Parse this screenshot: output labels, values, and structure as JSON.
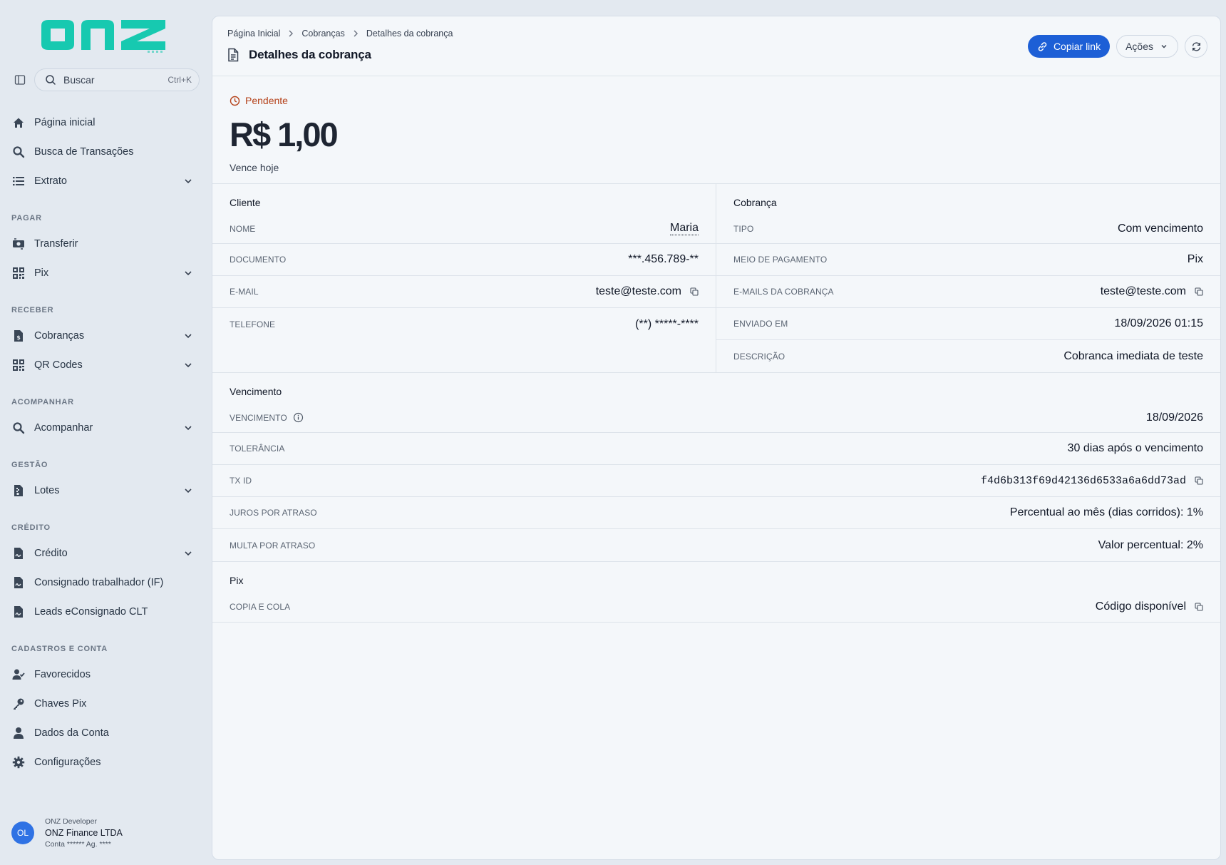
{
  "brand": {
    "logo_text": "onz",
    "accent": "#17c9b0"
  },
  "search": {
    "label": "Buscar",
    "shortcut": "Ctrl+K"
  },
  "nav": {
    "home": "Página inicial",
    "tx_search": "Busca de Transações",
    "statement": "Extrato",
    "sec_pay": "PAGAR",
    "transfer": "Transferir",
    "pix": "Pix",
    "sec_receive": "RECEBER",
    "charges": "Cobranças",
    "qrcodes": "QR Codes",
    "sec_track": "ACOMPANHAR",
    "track": "Acompanhar",
    "sec_mgmt": "GESTÃO",
    "batches": "Lotes",
    "sec_credit": "CRÉDITO",
    "credit": "Crédito",
    "payroll": "Consignado trabalhador (IF)",
    "leads": "Leads eConsignado CLT",
    "sec_account": "CADASTROS E CONTA",
    "favorites": "Favorecidos",
    "pix_keys": "Chaves Pix",
    "account_data": "Dados da Conta",
    "settings": "Configurações"
  },
  "account": {
    "initials": "OL",
    "role": "ONZ Developer",
    "company": "ONZ Finance LTDA",
    "details": "Conta ****** Ag. ****"
  },
  "breadcrumb": [
    "Página Inicial",
    "Cobranças",
    "Detalhes da cobrança"
  ],
  "page_title": "Detalhes da cobrança",
  "actions": {
    "copy_link": "Copiar link",
    "actions": "Ações"
  },
  "summary": {
    "status": "Pendente",
    "amount": "R$ 1,00",
    "due": "Vence hoje"
  },
  "client": {
    "title": "Cliente",
    "name_label": "NOME",
    "name": "Maria",
    "doc_label": "DOCUMENTO",
    "doc": "***.456.789-**",
    "email_label": "E-MAIL",
    "email": "teste@teste.com",
    "phone_label": "TELEFONE",
    "phone": "(**) *****-****"
  },
  "charge": {
    "title": "Cobrança",
    "type_label": "TIPO",
    "type": "Com vencimento",
    "method_label": "MEIO DE PAGAMENTO",
    "method": "Pix",
    "emails_label": "E-MAILS DA COBRANÇA",
    "emails": "teste@teste.com",
    "sent_label": "ENVIADO EM",
    "sent": "18/09/2026 01:15",
    "desc_label": "DESCRIÇÃO",
    "desc": "Cobranca imediata de teste"
  },
  "due_section": {
    "title": "Vencimento",
    "due_label": "VENCIMENTO",
    "due": "18/09/2026",
    "tol_label": "TOLERÂNCIA",
    "tol": "30 dias após o vencimento",
    "txid_label": "TX ID",
    "txid": "f4d6b313f69d42136d6533a6a6dd73ad",
    "interest_label": "JUROS POR ATRASO",
    "interest": "Percentual ao mês (dias corridos): 1%",
    "fine_label": "MULTA POR ATRASO",
    "fine": "Valor percentual: 2%"
  },
  "pix_section": {
    "title": "Pix",
    "copy_label": "COPIA E COLA",
    "copy": "Código disponível"
  }
}
